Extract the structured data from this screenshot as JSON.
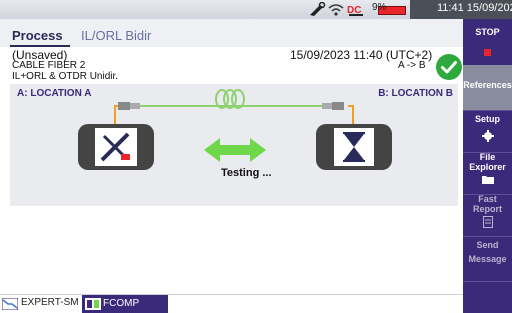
{
  "status": {
    "battery_percent": "9%",
    "time": "11:41",
    "date": "15/09/2023",
    "icons": [
      "tools-icon",
      "wifi-icon",
      "dc-power-icon",
      "battery-icon"
    ]
  },
  "tabs": [
    {
      "label": "Process",
      "active": true
    },
    {
      "label": "IL/ORL Bidir",
      "active": false
    }
  ],
  "info": {
    "name": "(Unsaved)",
    "cable": "CABLE FIBER 2",
    "test_type": "IL+ORL & OTDR Unidir.",
    "datetime": "15/09/2023 11:40 (UTC+2)",
    "direction": "A -> B",
    "status_icon": "check-circle-icon"
  },
  "diagram": {
    "location_a": "A: LOCATION A",
    "location_b": "B: LOCATION B",
    "state_text": "Testing ...",
    "icons": [
      "tools-device-icon",
      "fiber-coil-icon",
      "bidirectional-arrow-icon",
      "hourglass-device-icon"
    ]
  },
  "sidebar": {
    "stop": "STOP",
    "reference": "References",
    "setup": "Setup",
    "file_explorer_1": "File",
    "file_explorer_2": "Explorer",
    "fast_report_1": "Fast",
    "fast_report_2": "Report",
    "send_message_1": "Send",
    "send_message_2": "Message"
  },
  "bottombar": {
    "expert": "EXPERT-SM",
    "fcomp": "FCOMP"
  },
  "colors": {
    "accent": "#3a2a7a",
    "check": "#2eaa3c",
    "fiber": "#8fd170",
    "stop": "#e9242a"
  }
}
